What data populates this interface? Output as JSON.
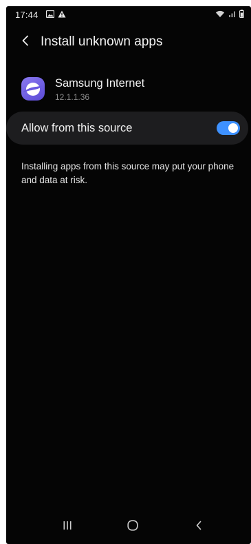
{
  "status_bar": {
    "time": "17:44",
    "left_icons": [
      "image-icon",
      "warning-icon"
    ],
    "right_icons": [
      "wifi-icon",
      "signal-icon",
      "battery-icon"
    ]
  },
  "header": {
    "title": "Install unknown apps",
    "back_icon": "chevron-left-icon"
  },
  "app": {
    "name": "Samsung Internet",
    "version": "12.1.1.36",
    "icon": "samsung-internet-icon"
  },
  "setting": {
    "label": "Allow from this source",
    "enabled": true,
    "toggle_color": "#3e91ff"
  },
  "description": "Installing apps from this source may put your phone and data at risk.",
  "nav_bar": {
    "buttons": [
      "recent-apps-icon",
      "home-icon",
      "back-icon"
    ]
  },
  "colors": {
    "background": "#050505",
    "row_background": "#1d1d1f",
    "accent": "#3e91ff"
  }
}
